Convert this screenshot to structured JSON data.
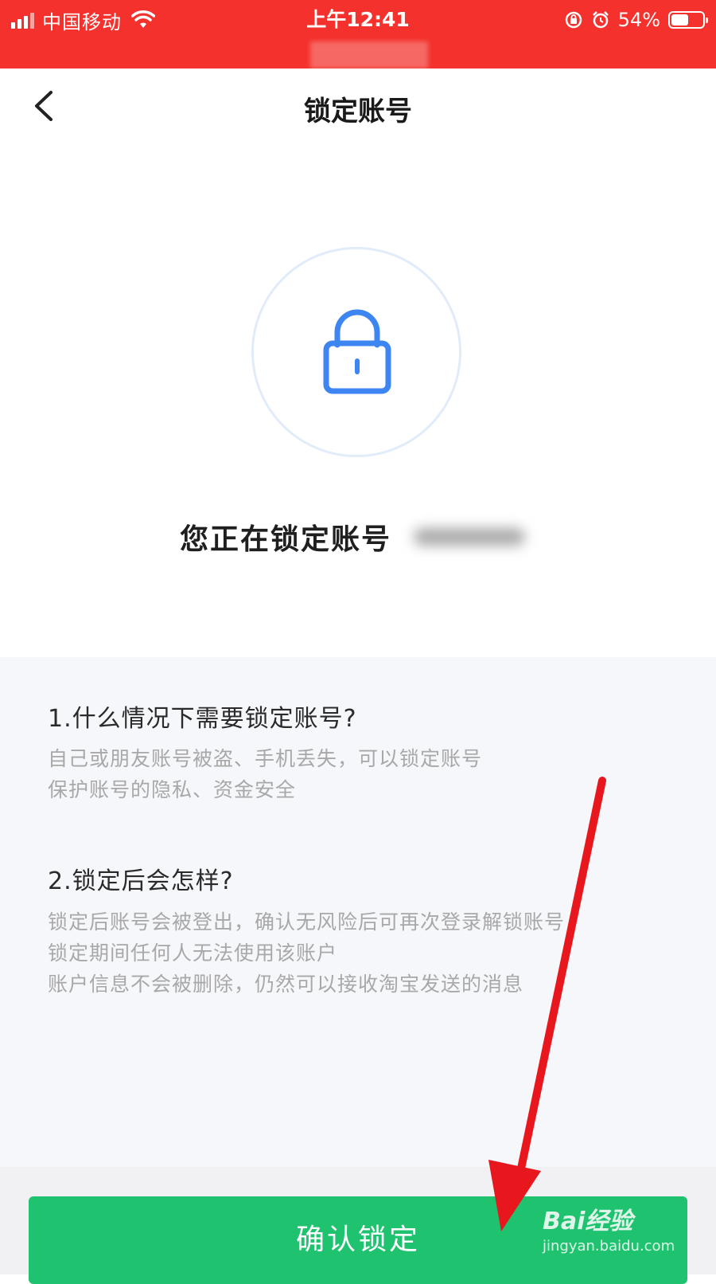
{
  "status_bar": {
    "carrier": "中国移动",
    "time": "上午12:41",
    "battery": "54%",
    "battery_level": 0.54
  },
  "header": {
    "title": "锁定账号"
  },
  "lock": {
    "icon": "lock-icon",
    "color": "#3d85f0"
  },
  "main": {
    "locking_text": "您正在锁定账号"
  },
  "info": {
    "q1": "1.什么情况下需要锁定账号?",
    "a1": [
      "自己或朋友账号被盗、手机丢失，可以锁定账号",
      "保护账号的隐私、资金安全"
    ],
    "q2": "2.锁定后会怎样?",
    "a2": [
      "锁定后账号会被登出，确认无风险后可再次登录解锁账号",
      "锁定期间任何人无法使用该账户",
      "账户信息不会被删除，仍然可以接收淘宝发送的消息"
    ]
  },
  "footer": {
    "confirm_label": "确认锁定",
    "button_color": "#1fc36f"
  },
  "watermark": {
    "brand": "Bai经验",
    "url": "jingyan.baidu.com"
  }
}
